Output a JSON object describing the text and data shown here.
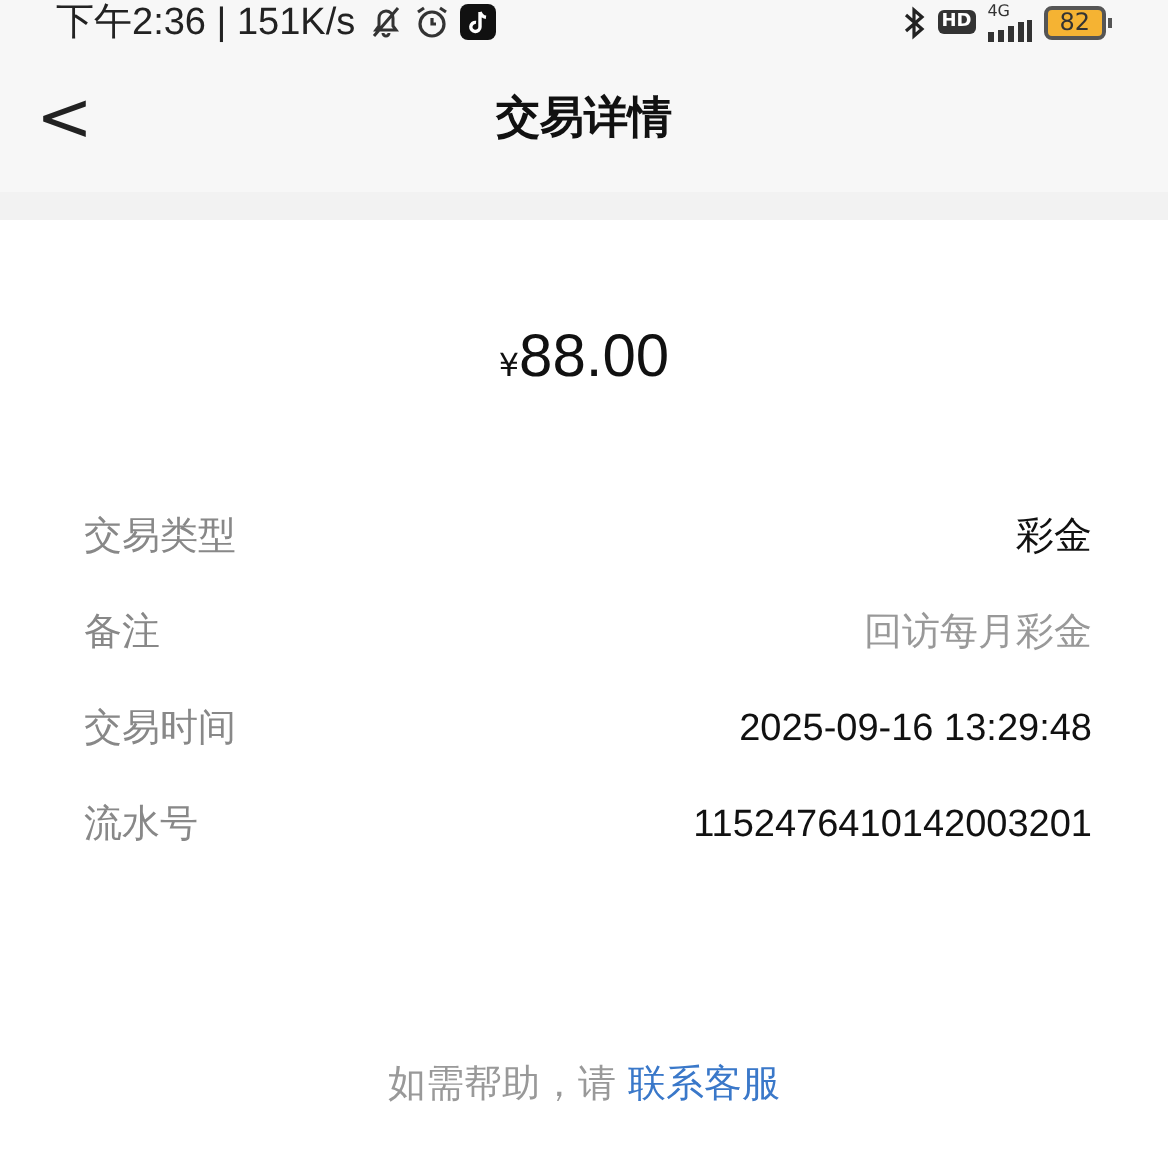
{
  "status_bar": {
    "time": "下午2:36 | 151K/s",
    "hd": "HD",
    "network": "4G",
    "battery": "82"
  },
  "header": {
    "back": "<",
    "title": "交易详情"
  },
  "amount": {
    "currency": "¥",
    "value": "88.00"
  },
  "details": [
    {
      "label": "交易类型",
      "value": "彩金",
      "kind": "strong"
    },
    {
      "label": "备注",
      "value": "回访每月彩金",
      "kind": "muted"
    },
    {
      "label": "交易时间",
      "value": "2025-09-16 13:29:48",
      "kind": "strong"
    },
    {
      "label": "流水号",
      "value": "1152476410142003201",
      "kind": "strong"
    }
  ],
  "help": {
    "text": "如需帮助，请",
    "link": "联系客服"
  }
}
